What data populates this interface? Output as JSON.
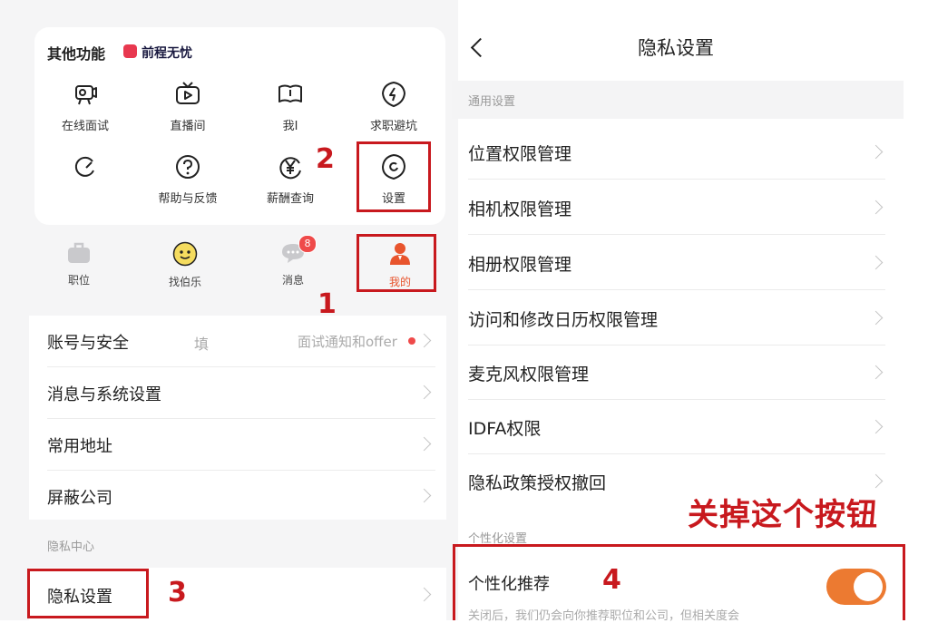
{
  "left": {
    "functions_title": "其他功能",
    "brand": "前程无忧",
    "functions": [
      {
        "label": "在线面试",
        "icon": "video-interview-icon"
      },
      {
        "label": "直播间",
        "icon": "live-tv-icon"
      },
      {
        "label": "我I",
        "icon": "book-icon"
      },
      {
        "label": "求职避坑",
        "icon": "lightning-shield-icon"
      },
      {
        "label": "",
        "icon": "refresh-icon"
      },
      {
        "label": "帮助与反馈",
        "icon": "help-icon"
      },
      {
        "label": "薪酬查询",
        "icon": "salary-yen-icon"
      },
      {
        "label": "设置",
        "icon": "settings-icon"
      }
    ],
    "tabbar": [
      {
        "label": "职位",
        "icon": "briefcase-icon"
      },
      {
        "label": "找伯乐",
        "icon": "smiley-icon"
      },
      {
        "label": "消息",
        "icon": "chat-bubble-icon",
        "badge": "8"
      },
      {
        "label": "我的",
        "icon": "person-icon"
      }
    ],
    "menu": [
      {
        "label": "账号与安全",
        "hint_left": "填",
        "hint_right": "面试通知和offer"
      },
      {
        "label": "消息与系统设置"
      },
      {
        "label": "常用地址"
      },
      {
        "label": "屏蔽公司"
      }
    ],
    "privacy_section": "隐私中心",
    "privacy_settings": "隐私设置"
  },
  "right": {
    "title": "隐私设置",
    "general_section": "通用设置",
    "rows": [
      "位置权限管理",
      "相机权限管理",
      "相册权限管理",
      "访问和修改日历权限管理",
      "麦克风权限管理",
      "IDFA权限",
      "隐私政策授权撤回"
    ],
    "personal_section": "个性化设置",
    "personal_recommend": "个性化推荐",
    "personal_desc": "关闭后，我们仍会向你推荐职位和公司，但相关度会",
    "toggle_on": true
  },
  "annotations": {
    "n1": "1",
    "n2": "2",
    "n3": "3",
    "n4": "4",
    "instruction": "关掉这个按钮"
  },
  "colors": {
    "accent": "#ec7a31",
    "annotation_red": "#c8191e",
    "badge_red": "#ef4a4a"
  }
}
